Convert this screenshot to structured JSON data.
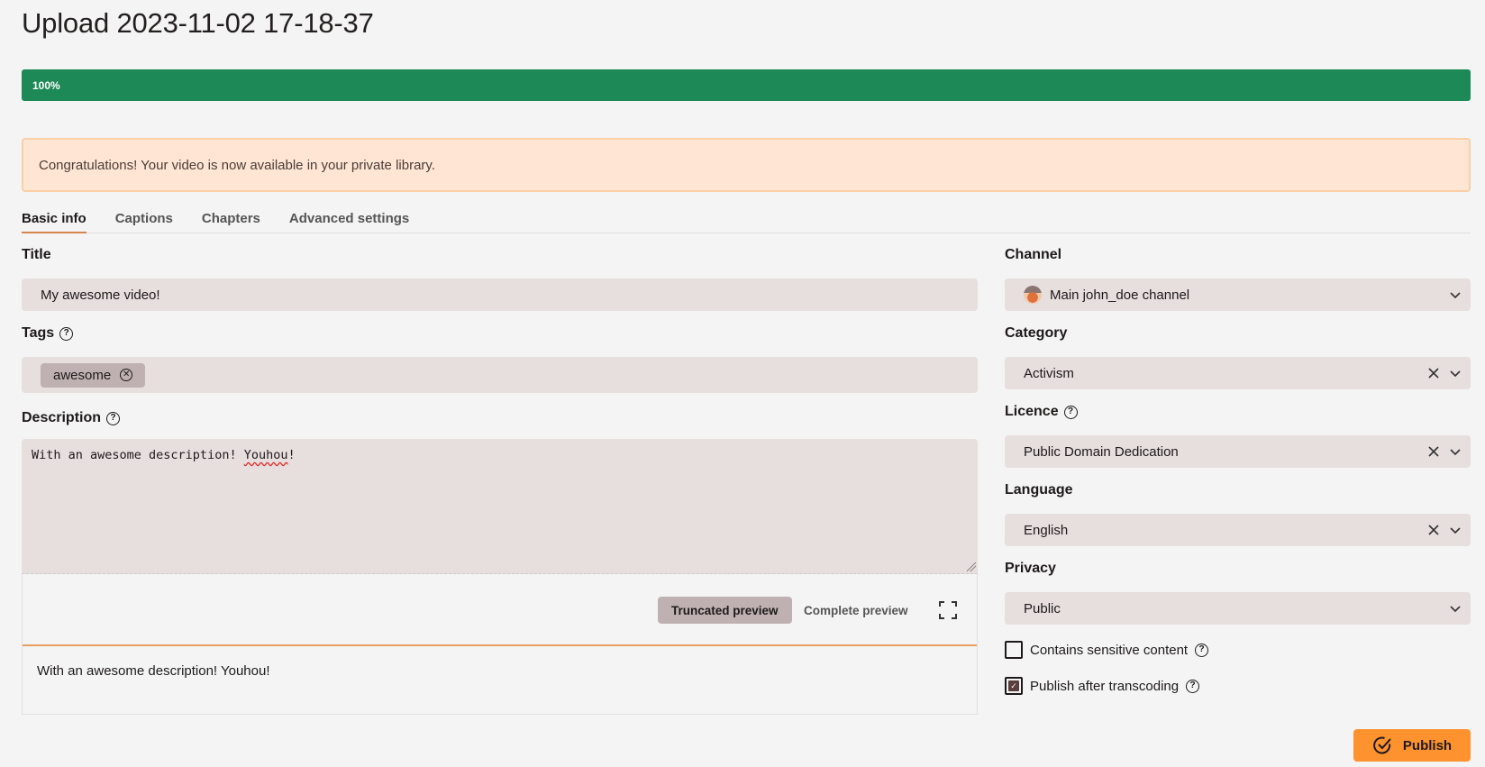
{
  "page": {
    "title": "Upload 2023-11-02 17-18-37"
  },
  "progress": {
    "value_percent": 100,
    "label": "100%",
    "color": "#1c8956"
  },
  "alert": {
    "message": "Congratulations! Your video is now available in your private library."
  },
  "tabs": [
    {
      "label": "Basic info",
      "active": true
    },
    {
      "label": "Captions",
      "active": false
    },
    {
      "label": "Chapters",
      "active": false
    },
    {
      "label": "Advanced settings",
      "active": false
    }
  ],
  "form": {
    "title": {
      "label": "Title",
      "value": "My awesome video!"
    },
    "tags": {
      "label": "Tags",
      "help_icon": "help-circle-icon",
      "items": [
        "awesome"
      ]
    },
    "description": {
      "label": "Description",
      "help_icon": "help-circle-icon",
      "value_plain": "With an awesome description! ",
      "value_misspelled": "Youhou",
      "value_tail": "!",
      "preview_buttons": {
        "truncated": "Truncated preview",
        "complete": "Complete preview"
      },
      "preview_text": "With an awesome description! Youhou!"
    }
  },
  "sidebar": {
    "channel": {
      "label": "Channel",
      "value": "Main john_doe channel"
    },
    "category": {
      "label": "Category",
      "value": "Activism"
    },
    "licence": {
      "label": "Licence",
      "value": "Public Domain Dedication"
    },
    "language": {
      "label": "Language",
      "value": "English"
    },
    "privacy": {
      "label": "Privacy",
      "value": "Public"
    },
    "checkboxes": [
      {
        "label": "Contains sensitive content",
        "checked": false
      },
      {
        "label": "Publish after transcoding",
        "checked": true
      }
    ]
  },
  "actions": {
    "publish_label": "Publish",
    "publish_color": "#fe922f"
  }
}
